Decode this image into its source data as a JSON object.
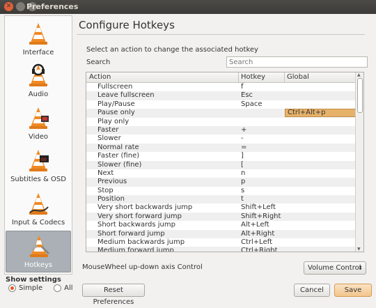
{
  "window": {
    "title": "Preferences"
  },
  "sidebar": {
    "items": [
      {
        "label": "Interface",
        "icon": "vlc-cone-icon"
      },
      {
        "label": "Audio",
        "icon": "vlc-cone-headphones-icon"
      },
      {
        "label": "Video",
        "icon": "vlc-cone-film-icon"
      },
      {
        "label": "Subtitles & OSD",
        "icon": "vlc-cone-clapper-icon"
      },
      {
        "label": "Input & Codecs",
        "icon": "vlc-cone-cable-icon"
      },
      {
        "label": "Hotkeys",
        "icon": "vlc-cone-keys-icon",
        "selected": true
      }
    ]
  },
  "show_settings": {
    "label": "Show settings",
    "options": [
      "Simple",
      "All"
    ],
    "selected": "Simple"
  },
  "panel": {
    "title": "Configure Hotkeys",
    "instruction": "Select an action to change the associated hotkey",
    "search_label": "Search",
    "search_placeholder": "Search"
  },
  "table": {
    "columns": [
      "Action",
      "Hotkey",
      "Global"
    ],
    "rows": [
      {
        "action": "Fullscreen",
        "hotkey": "f",
        "global": ""
      },
      {
        "action": "Leave fullscreen",
        "hotkey": "Esc",
        "global": ""
      },
      {
        "action": "Play/Pause",
        "hotkey": "Space",
        "global": ""
      },
      {
        "action": "Pause only",
        "hotkey": "",
        "global": "Ctrl+Alt+p",
        "global_selected": true
      },
      {
        "action": "Play only",
        "hotkey": "",
        "global": ""
      },
      {
        "action": "Faster",
        "hotkey": "+",
        "global": ""
      },
      {
        "action": "Slower",
        "hotkey": "-",
        "global": ""
      },
      {
        "action": "Normal rate",
        "hotkey": "=",
        "global": ""
      },
      {
        "action": "Faster (fine)",
        "hotkey": "]",
        "global": ""
      },
      {
        "action": "Slower (fine)",
        "hotkey": "[",
        "global": ""
      },
      {
        "action": "Next",
        "hotkey": "n",
        "global": ""
      },
      {
        "action": "Previous",
        "hotkey": "p",
        "global": ""
      },
      {
        "action": "Stop",
        "hotkey": "s",
        "global": ""
      },
      {
        "action": "Position",
        "hotkey": "t",
        "global": ""
      },
      {
        "action": "Very short backwards jump",
        "hotkey": "Shift+Left",
        "global": ""
      },
      {
        "action": "Very short forward jump",
        "hotkey": "Shift+Right",
        "global": ""
      },
      {
        "action": "Short backwards jump",
        "hotkey": "Alt+Left",
        "global": ""
      },
      {
        "action": "Short forward jump",
        "hotkey": "Alt+Right",
        "global": ""
      },
      {
        "action": "Medium backwards jump",
        "hotkey": "Ctrl+Left",
        "global": ""
      },
      {
        "action": "Medium forward jump",
        "hotkey": "Ctrl+Right",
        "global": ""
      }
    ]
  },
  "mousewheel": {
    "label": "MouseWheel up-down axis Control",
    "value": "Volume Control"
  },
  "buttons": {
    "reset": "Reset Preferences",
    "cancel": "Cancel",
    "save": "Save"
  },
  "colors": {
    "accent": "#e95420",
    "selected_cell": "#e6b26a",
    "titlebar": "#3c3b37"
  }
}
